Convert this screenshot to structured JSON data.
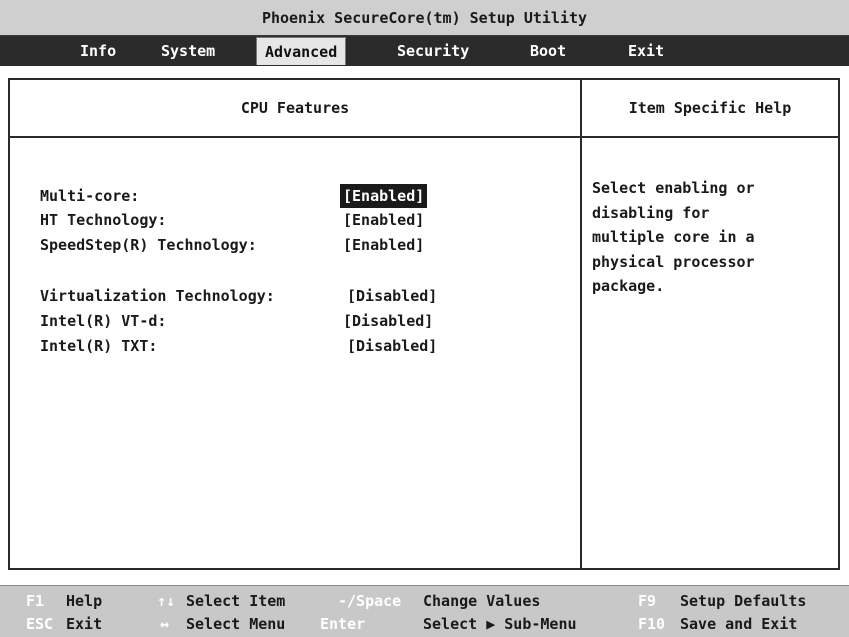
{
  "title": "Phoenix SecureCore(tm) Setup Utility",
  "menu": [
    "Info",
    "System",
    "Advanced",
    "Security",
    "Boot",
    "Exit"
  ],
  "active_menu": "Advanced",
  "panel": {
    "left_title": "CPU Features",
    "right_title": "Item Specific Help"
  },
  "settings": [
    {
      "label": "Multi-core:",
      "value": "[Enabled]",
      "selected": true
    },
    {
      "label": "HT Technology:",
      "value": "[Enabled]"
    },
    {
      "label": "SpeedStep(R) Technology:",
      "value": "[Enabled]"
    },
    {
      "label": "Virtualization Technology:",
      "value": "[Disabled]"
    },
    {
      "label": "Intel(R) VT-d:",
      "value": "[Disabled]"
    },
    {
      "label": "Intel(R) TXT:",
      "value": "[Disabled]"
    }
  ],
  "help_text": "Select enabling or\ndisabling for\nmultiple core in a\nphysical processor\npackage.",
  "footer": {
    "row1": [
      {
        "key": "F1",
        "desc": "Help"
      },
      {
        "key": "↑↓",
        "desc": "Select Item"
      },
      {
        "key": "-/Space",
        "desc": "Change Values"
      },
      {
        "key": "F9",
        "desc": "Setup Defaults"
      }
    ],
    "row2": [
      {
        "key": "ESC",
        "desc": "Exit"
      },
      {
        "key": "↔",
        "desc": "Select Menu"
      },
      {
        "key": "Enter",
        "desc": "Select ▶ Sub-Menu"
      },
      {
        "key": "F10",
        "desc": "Save and Exit"
      }
    ]
  },
  "colors": {
    "menu_bg": "#2b2b2b",
    "title_bg": "#cfcfcf",
    "footer_bg": "#c8c8c8",
    "selected_bg": "#1a1a1a"
  }
}
